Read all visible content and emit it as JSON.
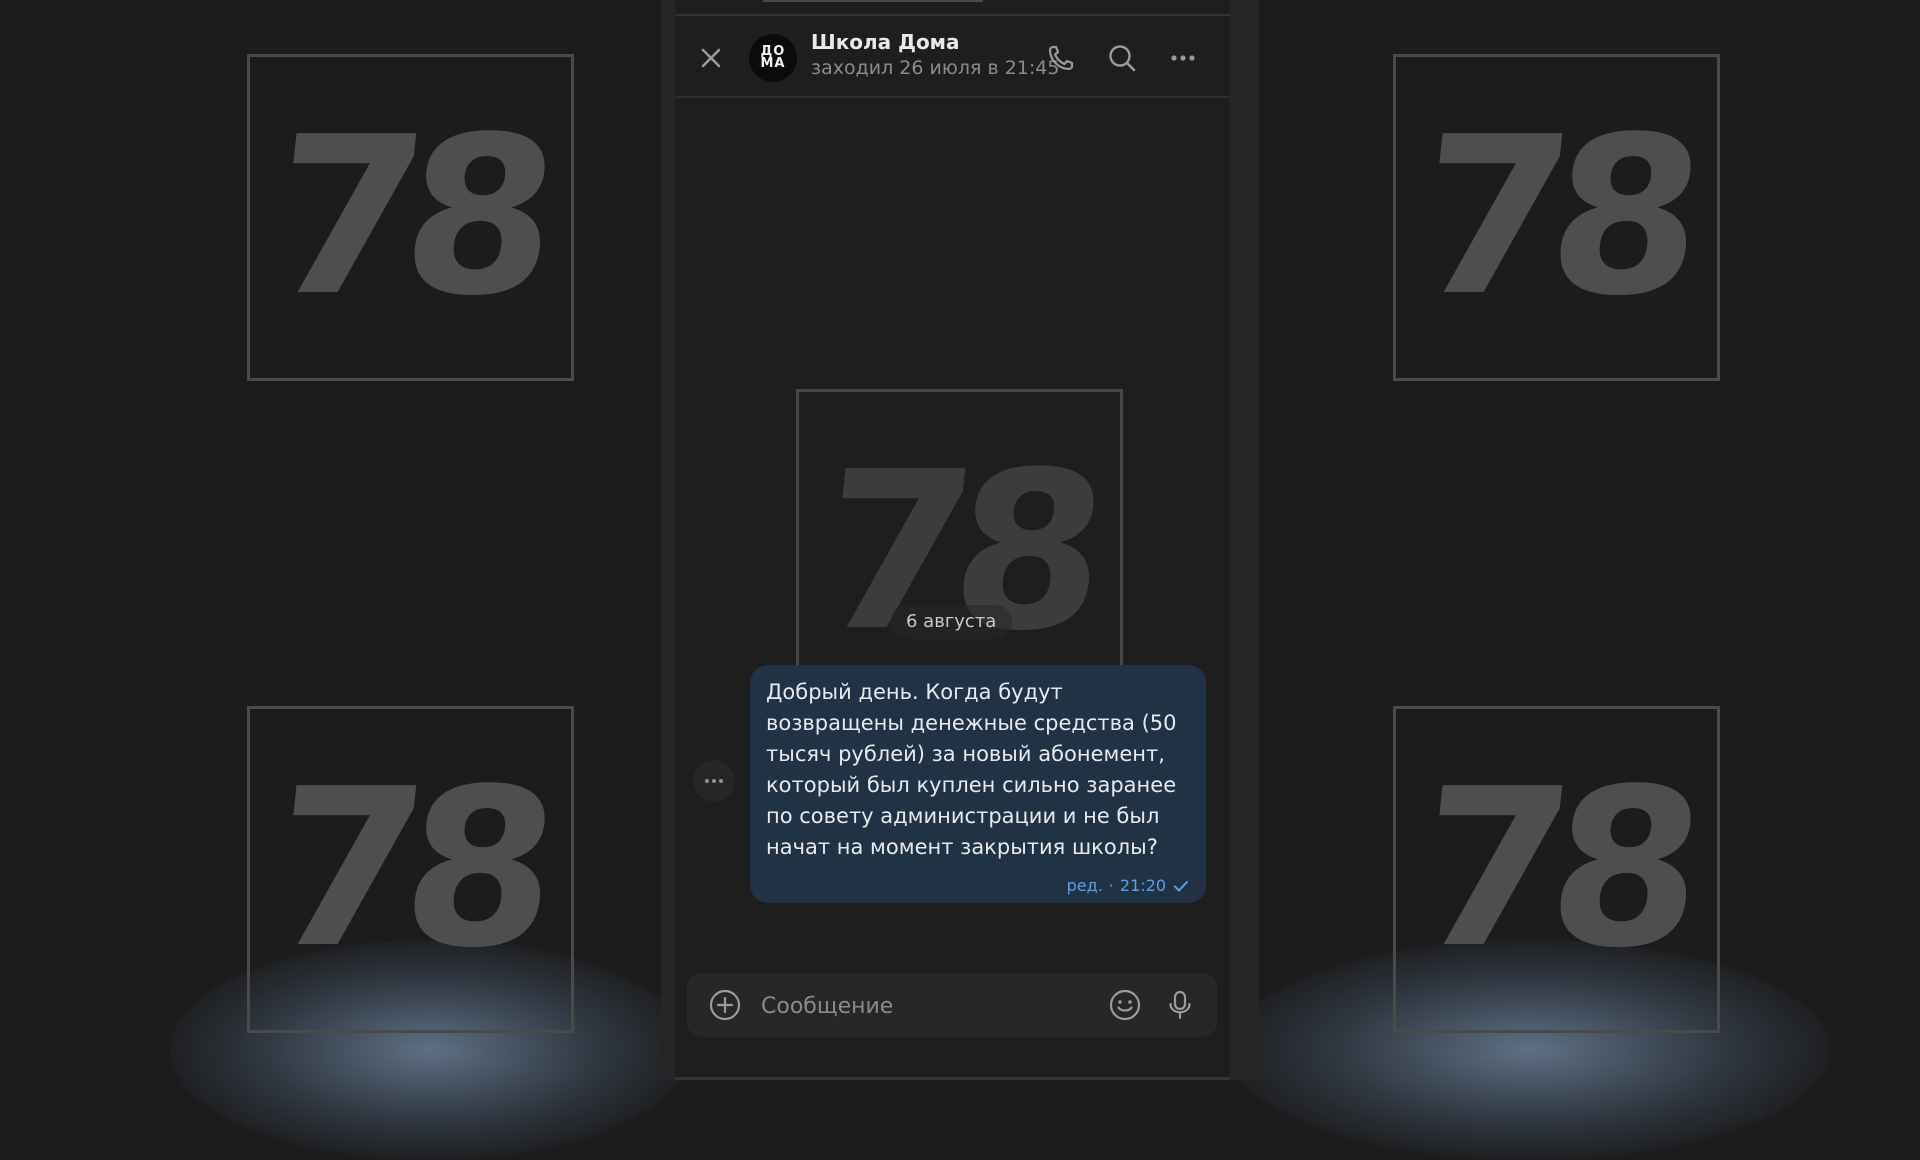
{
  "background": {
    "watermark_text": "78"
  },
  "chat": {
    "title": "Школа Дома",
    "status": "заходил 26 июля в 21:45",
    "avatar_text_line1": "ДО",
    "avatar_text_line2": "МА"
  },
  "header": {
    "icons": [
      "close-icon",
      "phone-icon",
      "search-icon",
      "more-icon"
    ]
  },
  "messages": [
    {
      "date_label": "6 августа",
      "text": "Добрый день. Когда будут\nвозвращены денежные средства (50\nтысяч рублей) за новый абонемент,\nкоторый был куплен сильно заранее\nпо совету администрации и не был\nначат на момент закрытия школы?",
      "edited_label": "ред.",
      "separator": "·",
      "time": "21:20",
      "status": "sent"
    }
  ],
  "composer": {
    "placeholder": "Сообщение",
    "value": ""
  },
  "colors": {
    "accent": "#5aa0e8",
    "bubble": "#223245",
    "background": "#1c1c1d"
  }
}
